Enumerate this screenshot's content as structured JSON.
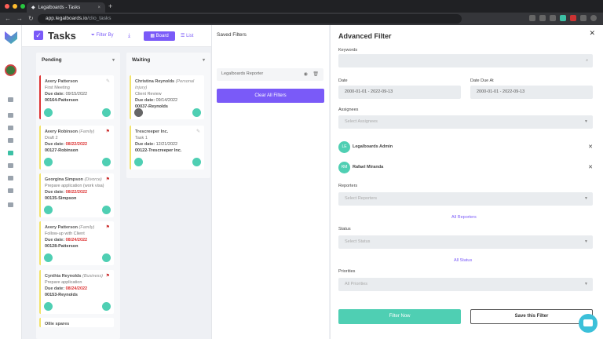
{
  "browser": {
    "tab_title": "Legalboards - Tasks",
    "url_host": "app.legalboards.io",
    "url_path": "/clio_tasks"
  },
  "header": {
    "title": "Tasks",
    "filter_label": "Filter By",
    "board_label": "Board",
    "list_label": "List"
  },
  "columns": [
    {
      "name": "Pending",
      "cards": [
        {
          "name": "Avery Patterson",
          "tag": "",
          "task": "First Meeting",
          "due_label": "Due date:",
          "due": "09/15/2022",
          "id": "00164-Patterson",
          "late": false
        },
        {
          "name": "Avery Robinson",
          "tag": "(Family)",
          "task": "Draft 2",
          "due_label": "Due date:",
          "due": "08/22/2022",
          "id": "00127-Robinson",
          "late": true
        },
        {
          "name": "Georgina Simpson",
          "tag": "(Divorce)",
          "task": "Prepare application (work visa)",
          "due_label": "Due date:",
          "due": "08/22/2022",
          "id": "00135-Simpson",
          "late": true
        },
        {
          "name": "Avery Patterson",
          "tag": "(Family)",
          "task": "Follow-up with Client",
          "due_label": "Due date:",
          "due": "08/24/2022",
          "id": "00128-Patterson",
          "late": true
        },
        {
          "name": "Cynthia Reynolds",
          "tag": "(Business)",
          "task": "Prepare application",
          "due_label": "Due date:",
          "due": "08/24/2022",
          "id": "00153-Reynolds",
          "late": true
        },
        {
          "name": "Ollie spares",
          "tag": "",
          "task": "",
          "due_label": "",
          "due": "",
          "id": "",
          "late": false
        }
      ]
    },
    {
      "name": "Waiting",
      "cards": [
        {
          "name": "Christina Reynolds",
          "tag": "(Personal Injury)",
          "task": "Client Review",
          "due_label": "Due date:",
          "due": "09/14/2022",
          "id": "00037-Reynolds",
          "late": false
        },
        {
          "name": "Trescreeper Inc.",
          "tag": "",
          "task": "Task 1",
          "due_label": "Due date:",
          "due": "12/21/2022",
          "id": "00122-Trescreeper Inc.",
          "late": false
        }
      ]
    }
  ],
  "saved_filters": {
    "title": "Saved Filters",
    "items": [
      "Legalboards Reporter"
    ],
    "clear_label": "Clear All Filters"
  },
  "advanced": {
    "title": "Advanced Filter",
    "keywords_label": "Keywords",
    "keywords_value": "",
    "date_label": "Date",
    "date_value": "2000-01-01 - 2022-09-13",
    "date_due_label": "Date Due At",
    "date_due_value": "2000-01-01 - 2022-09-13",
    "assignees_label": "Assignees",
    "assignees_placeholder": "Select Assignees",
    "assignees": [
      {
        "initials": "LE",
        "name": "Legalboards Admin"
      },
      {
        "initials": "RM",
        "name": "Rafael Miranda"
      }
    ],
    "reporters_label": "Reporters",
    "reporters_placeholder": "Select Reporters",
    "all_reporters": "All Reporters",
    "status_label": "Status",
    "status_placeholder": "Select Status",
    "all_status": "All Status",
    "priorities_label": "Priorities",
    "priorities_placeholder": "All Priorities",
    "filter_now": "Filter Now",
    "save_filter": "Save this Filter"
  }
}
